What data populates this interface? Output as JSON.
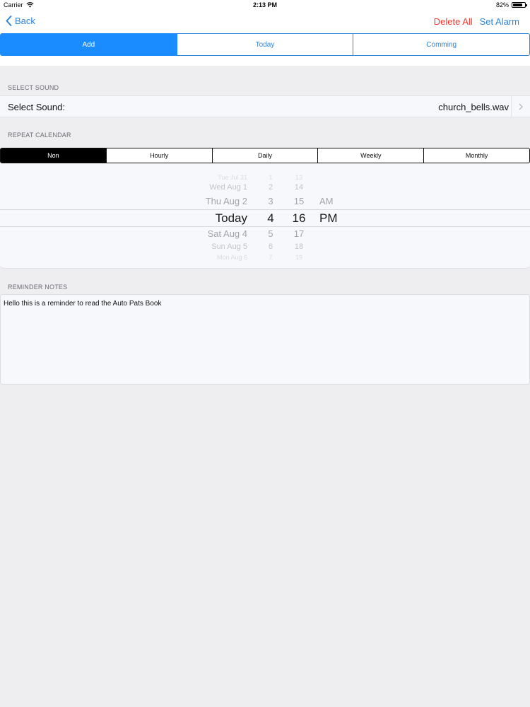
{
  "status_bar": {
    "carrier": "Carrier",
    "time": "2:13 PM",
    "battery": "82%",
    "battery_level": 0.82
  },
  "nav": {
    "back_label": "Back",
    "delete_all_label": "Delete All",
    "set_alarm_label": "Set Alarm"
  },
  "top_tabs": [
    {
      "label": "Add",
      "selected": true
    },
    {
      "label": "Today",
      "selected": false
    },
    {
      "label": "Comming",
      "selected": false
    }
  ],
  "select_sound": {
    "header": "SELECT SOUND",
    "label": "Select Sound:",
    "value": "church_bells.wav"
  },
  "repeat_calendar": {
    "header": "REPEAT CALENDAR",
    "options": [
      {
        "label": "Non",
        "selected": true
      },
      {
        "label": "Hourly",
        "selected": false
      },
      {
        "label": "Daily",
        "selected": false
      },
      {
        "label": "Weekly",
        "selected": false
      },
      {
        "label": "Monthly",
        "selected": false
      }
    ]
  },
  "picker": {
    "dates": [
      "Tue Jul 31",
      "Wed Aug 1",
      "Thu Aug 2",
      "Today",
      "Sat Aug 4",
      "Sun Aug 5",
      "Mon Aug 6"
    ],
    "hours": [
      "1",
      "2",
      "3",
      "4",
      "5",
      "6",
      "7"
    ],
    "minutes": [
      "13",
      "14",
      "15",
      "16",
      "17",
      "18",
      "19"
    ],
    "ampm": [
      "AM",
      "PM"
    ],
    "selected": {
      "date": "Today",
      "hour": "4",
      "minute": "16",
      "ampm": "PM"
    }
  },
  "reminder_notes": {
    "header": "REMINDER NOTES",
    "text": "Hello this is a reminder to read the Auto Pats Book"
  },
  "colors": {
    "accent_blue": "#1a8cff",
    "link_blue": "#2f86d6",
    "destructive_red": "#e8392f"
  }
}
